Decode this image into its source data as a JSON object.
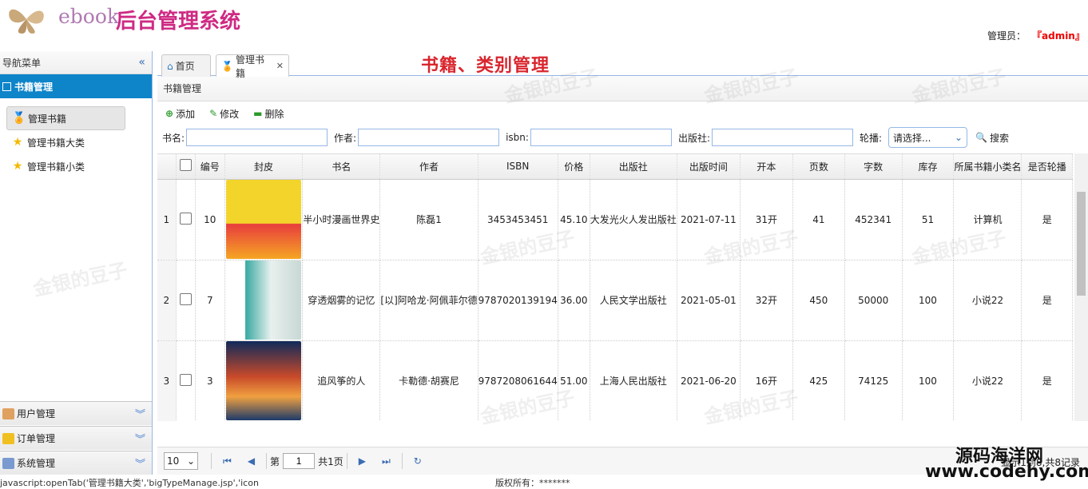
{
  "header": {
    "brand_en": "ebook",
    "brand_cn": "后台管理系统",
    "admin_label": "管理员：",
    "admin_name": "『admin』"
  },
  "sidebar": {
    "title": "导航菜单",
    "collapse_icon": "double-chevron-left",
    "group_title": "书籍管理",
    "items": [
      {
        "label": "管理书籍",
        "icon": "medal-icon",
        "active": true
      },
      {
        "label": "管理书籍大类",
        "icon": "star-icon"
      },
      {
        "label": "管理书籍小类",
        "icon": "star-icon"
      }
    ],
    "accordions": [
      {
        "label": "用户管理",
        "icon": "users-icon"
      },
      {
        "label": "订单管理",
        "icon": "folder-icon"
      },
      {
        "label": "系统管理",
        "icon": "settings-icon"
      }
    ]
  },
  "tabs": [
    {
      "label": "首页",
      "icon": "home-icon"
    },
    {
      "label": "管理书籍",
      "icon": "medal-icon",
      "closable": true
    }
  ],
  "overlay_title": "书籍、类别管理",
  "panel_title": "书籍管理",
  "toolbar": {
    "add": "添加",
    "edit": "修改",
    "delete": "删除"
  },
  "search": {
    "name_label": "书名:",
    "author_label": "作者:",
    "isbn_label": "isbn:",
    "publisher_label": "出版社:",
    "carousel_label": "轮播:",
    "carousel_placeholder": "请选择...",
    "search_button": "搜索"
  },
  "table": {
    "columns": [
      "",
      "",
      "编号",
      "封皮",
      "书名",
      "作者",
      "ISBN",
      "价格",
      "出版社",
      "出版时间",
      "开本",
      "页数",
      "字数",
      "库存",
      "所属书籍小类名",
      "是否轮播"
    ],
    "rows": [
      {
        "rn": "1",
        "id": "10",
        "cover": "yellow",
        "name": "半小时漫画世界史",
        "author": "陈磊1",
        "isbn": "3453453451",
        "price": "45.10",
        "publisher": "大发光火人发出版社",
        "date": "2021-07-11",
        "format": "31开",
        "pages": "41",
        "words": "452341",
        "stock": "51",
        "category": "计算机",
        "carousel": "是"
      },
      {
        "rn": "2",
        "id": "7",
        "cover": "teal",
        "name": "穿透烟雾的记忆",
        "author": "[以]阿哈龙·阿佩菲尔德",
        "isbn": "9787020139194",
        "price": "36.00",
        "publisher": "人民文学出版社",
        "date": "2021-05-01",
        "format": "32开",
        "pages": "450",
        "words": "50000",
        "stock": "100",
        "category": "小说22",
        "carousel": "是"
      },
      {
        "rn": "3",
        "id": "3",
        "cover": "sunset",
        "name": "追风筝的人",
        "author": "卡勒德·胡赛尼",
        "isbn": "9787208061644",
        "price": "51.00",
        "publisher": "上海人民出版社",
        "date": "2021-06-20",
        "format": "16开",
        "pages": "425",
        "words": "74125",
        "stock": "100",
        "category": "小说22",
        "carousel": "是"
      }
    ]
  },
  "pager": {
    "page_size": "10",
    "page_prefix": "第",
    "page_value": "1",
    "page_suffix": "共1页",
    "info": "显示1到8,共8记录"
  },
  "statusbar": {
    "left": "javascript:openTab('管理书籍大类','bigTypeManage.jsp','icon",
    "mid": "版权所有：*******"
  },
  "watermarks": {
    "text": "金银的豆子",
    "site_name": "源码海洋网",
    "site_url": "www.codehy.com"
  }
}
